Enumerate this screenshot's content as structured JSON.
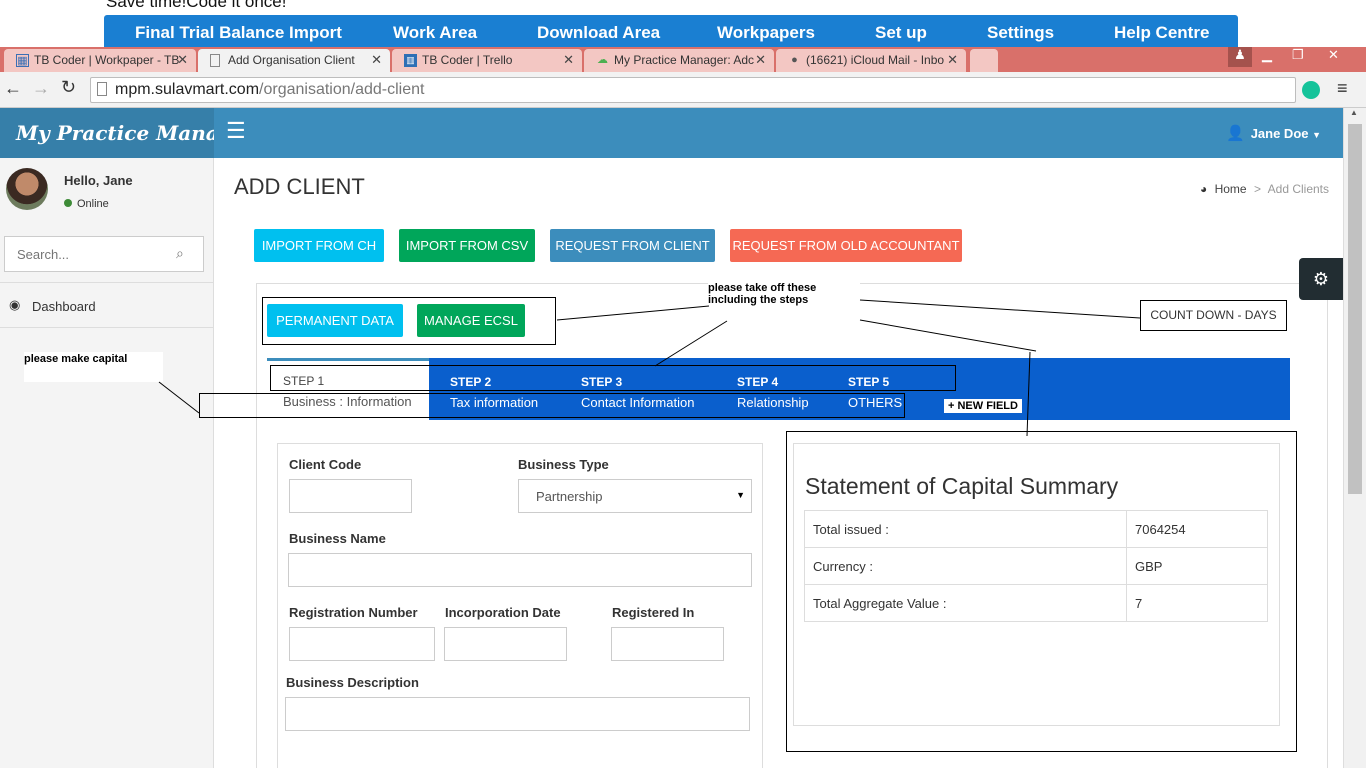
{
  "overlay": {
    "slogan": "Save time!Code it once!",
    "nav": [
      "Final Trial Balance Import",
      "Work Area",
      "Download Area",
      "Workpapers",
      "Set up",
      "Settings",
      "Help Centre"
    ]
  },
  "browser": {
    "tabs": [
      {
        "label": "TB Coder | Workpaper - TB",
        "icon": "spreadsheet-icon"
      },
      {
        "label": "Add Organisation Client",
        "icon": "page-icon"
      },
      {
        "label": "TB Coder | Trello",
        "icon": "trello-icon"
      },
      {
        "label": "My Practice Manager: Adc",
        "icon": "cloud-icon"
      },
      {
        "label": "(16621) iCloud Mail - Inbo",
        "icon": "apple-icon"
      }
    ],
    "url_host": "mpm.sulavmart.com",
    "url_path": "/organisation/add-client"
  },
  "app": {
    "brand": "My Practice Manager",
    "user_name": "Jane Doe",
    "greeting": "Hello, Jane",
    "status": "Online",
    "search_placeholder": "Search...",
    "menu_dashboard": "Dashboard",
    "page_title": "ADD CLIENT",
    "breadcrumb_home": "Home",
    "breadcrumb_sep": ">",
    "breadcrumb_current": "Add Clients",
    "colors": {
      "header": "#3c8dbc",
      "brand_bg": "#367fa9",
      "steps_bg": "#0a5fcd"
    }
  },
  "actions": {
    "import_ch": "IMPORT FROM CH",
    "import_csv": "IMPORT FROM CSV",
    "request_client": "REQUEST FROM CLIENT",
    "request_old": "REQUEST FROM OLD ACCOUNTANT",
    "permanent": "PERMANENT DATA",
    "manage_ecsl": "MANAGE ECSL"
  },
  "notes": {
    "take_off": "please take off these including the steps",
    "countdown": "COUNT DOWN - DAYS",
    "make_capital": "please make capital",
    "new_field": "+ NEW FIELD"
  },
  "steps": [
    {
      "step": "STEP 1",
      "name": "Business : Information"
    },
    {
      "step": "STEP 2",
      "name": "Tax information"
    },
    {
      "step": "STEP 3",
      "name": "Contact Information"
    },
    {
      "step": "STEP 4",
      "name": "Relationship"
    },
    {
      "step": "STEP 5",
      "name": "OTHERS"
    }
  ],
  "form": {
    "client_code": "Client Code",
    "business_type": "Business Type",
    "business_type_value": "Partnership",
    "business_name": "Business Name",
    "registration_number": "Registration Number",
    "incorporation_date": "Incorporation Date",
    "registered_in": "Registered In",
    "business_description": "Business Description"
  },
  "summary": {
    "title": "Statement of Capital Summary",
    "rows": [
      {
        "label": "Total issued :",
        "value": "7064254"
      },
      {
        "label": "Currency :",
        "value": "GBP"
      },
      {
        "label": "Total Aggregate Value :",
        "value": "7"
      }
    ]
  }
}
